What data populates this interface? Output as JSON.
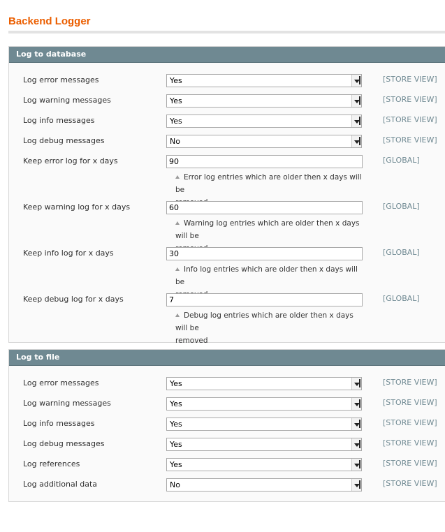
{
  "page": {
    "title": "Backend Logger"
  },
  "sections": {
    "db": {
      "title": "Log to database",
      "selects": [
        {
          "label": "Log error messages",
          "value": "Yes",
          "scope": "[STORE VIEW]"
        },
        {
          "label": "Log warning messages",
          "value": "Yes",
          "scope": "[STORE VIEW]"
        },
        {
          "label": "Log info messages",
          "value": "Yes",
          "scope": "[STORE VIEW]"
        },
        {
          "label": "Log debug messages",
          "value": "No",
          "scope": "[STORE VIEW]"
        }
      ],
      "inputs": [
        {
          "label": "Keep error log for x days",
          "value": "90",
          "scope": "[GLOBAL]",
          "note1": "Error log entries which are older then x days will be",
          "note2": "removed"
        },
        {
          "label": "Keep warning log for x days",
          "value": "60",
          "scope": "[GLOBAL]",
          "note1": "Warning log entries which are older then x days will be",
          "note2": "removed"
        },
        {
          "label": "Keep info log for x days",
          "value": "30",
          "scope": "[GLOBAL]",
          "note1": "Info log entries which are older then x days will be",
          "note2": "removed"
        },
        {
          "label": "Keep debug log for x days",
          "value": "7",
          "scope": "[GLOBAL]",
          "note1": "Debug log entries which are older then x days will be",
          "note2": "removed"
        }
      ]
    },
    "file": {
      "title": "Log to file",
      "selects": [
        {
          "label": "Log error messages",
          "value": "Yes",
          "scope": "[STORE VIEW]"
        },
        {
          "label": "Log warning messages",
          "value": "Yes",
          "scope": "[STORE VIEW]"
        },
        {
          "label": "Log info messages",
          "value": "Yes",
          "scope": "[STORE VIEW]"
        },
        {
          "label": "Log debug messages",
          "value": "Yes",
          "scope": "[STORE VIEW]"
        },
        {
          "label": "Log references",
          "value": "Yes",
          "scope": "[STORE VIEW]"
        },
        {
          "label": "Log additional data",
          "value": "No",
          "scope": "[STORE VIEW]"
        }
      ]
    }
  }
}
